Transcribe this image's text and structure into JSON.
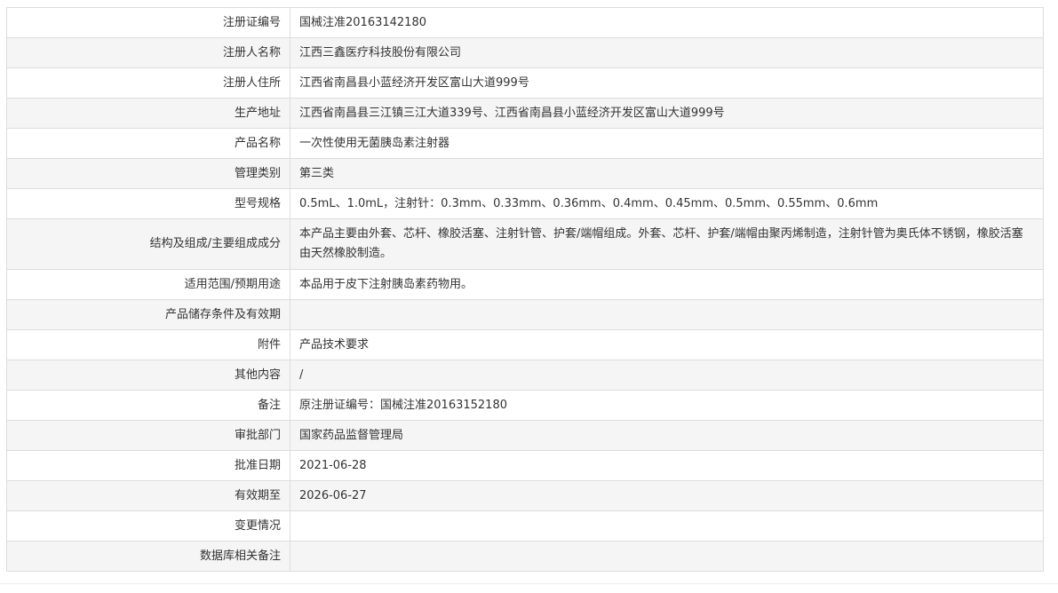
{
  "rows": [
    {
      "label": "注册证编号",
      "value": "国械注准20163142180"
    },
    {
      "label": "注册人名称",
      "value": "江西三鑫医疗科技股份有限公司"
    },
    {
      "label": "注册人住所",
      "value": "江西省南昌县小蓝经济开发区富山大道999号"
    },
    {
      "label": "生产地址",
      "value": "江西省南昌县三江镇三江大道339号、江西省南昌县小蓝经济开发区富山大道999号"
    },
    {
      "label": "产品名称",
      "value": "一次性使用无菌胰岛素注射器"
    },
    {
      "label": "管理类别",
      "value": "第三类"
    },
    {
      "label": "型号规格",
      "value": "0.5mL、1.0mL，注射针：0.3mm、0.33mm、0.36mm、0.4mm、0.45mm、0.5mm、0.55mm、0.6mm"
    },
    {
      "label": "结构及组成/主要组成成分",
      "value": "本产品主要由外套、芯杆、橡胶活塞、注射针管、护套/端帽组成。外套、芯杆、护套/端帽由聚丙烯制造，注射针管为奥氏体不锈钢，橡胶活塞由天然橡胶制造。"
    },
    {
      "label": "适用范围/预期用途",
      "value": "本品用于皮下注射胰岛素药物用。"
    },
    {
      "label": "产品储存条件及有效期",
      "value": ""
    },
    {
      "label": "附件",
      "value": "产品技术要求"
    },
    {
      "label": "其他内容",
      "value": "/"
    },
    {
      "label": "备注",
      "value": "原注册证编号：国械注准20163152180"
    },
    {
      "label": "审批部门",
      "value": "国家药品监督管理局"
    },
    {
      "label": "批准日期",
      "value": "2021-06-28"
    },
    {
      "label": "有效期至",
      "value": "2026-06-27"
    },
    {
      "label": "变更情况",
      "value": ""
    },
    {
      "label": "数据库相关备注",
      "value": ""
    }
  ]
}
